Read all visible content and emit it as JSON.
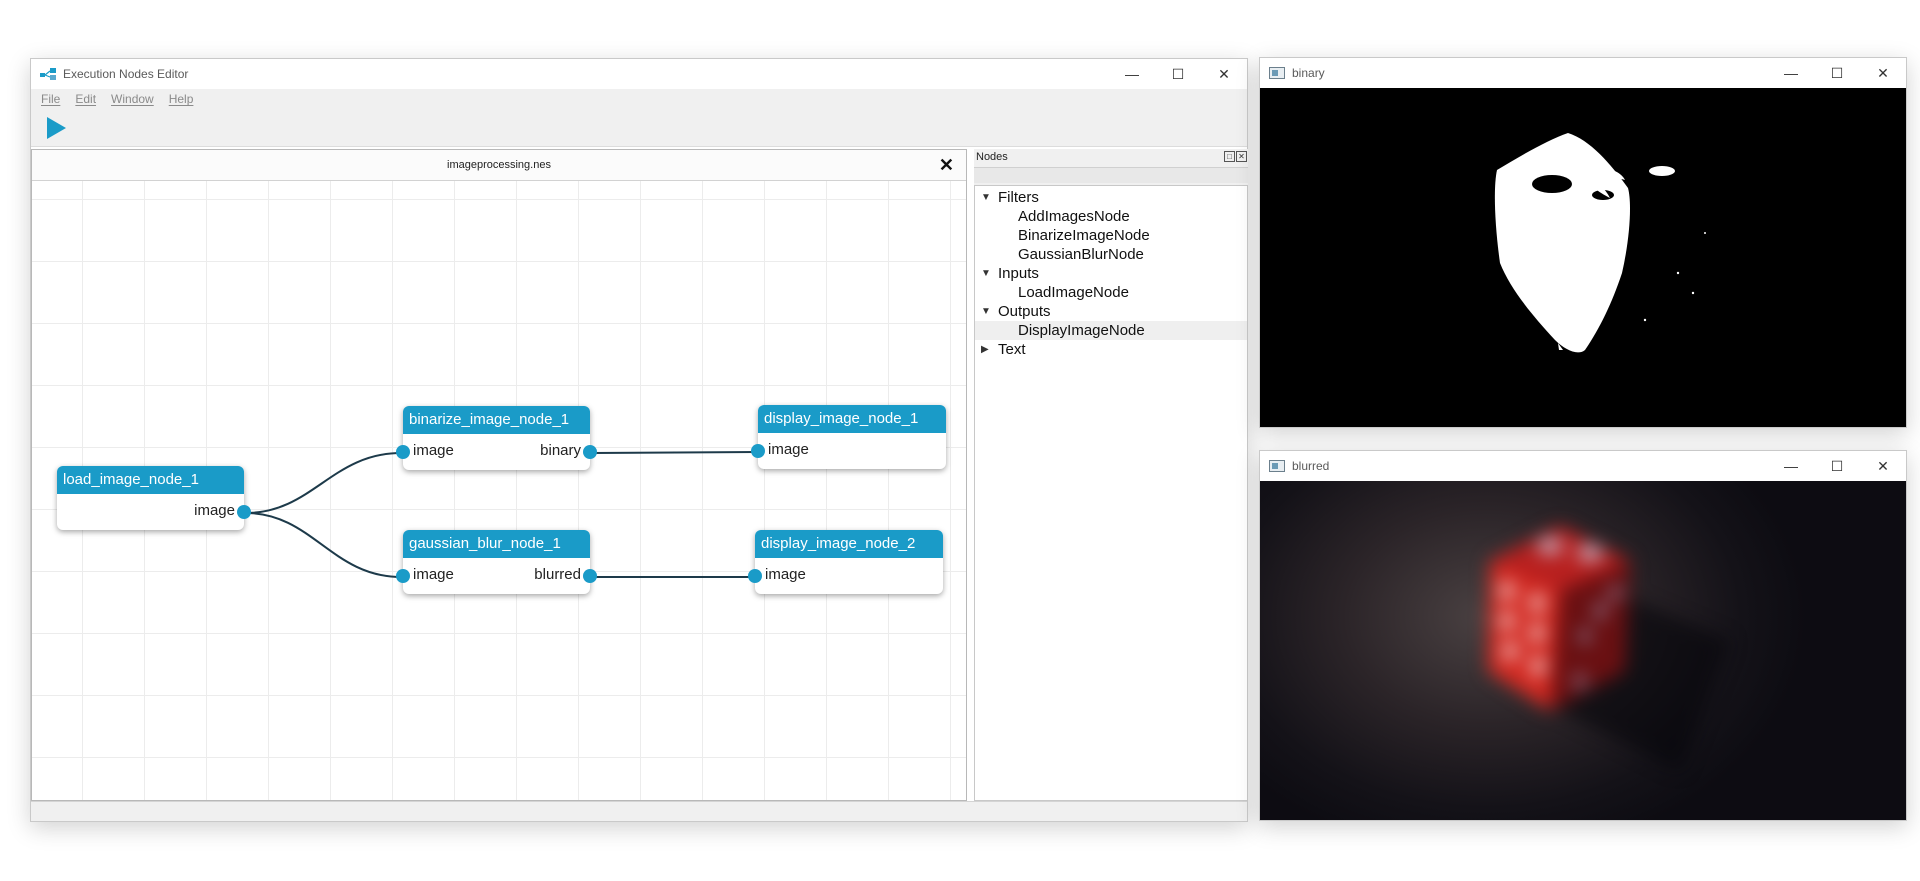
{
  "main_window": {
    "title": "Execution Nodes Editor",
    "menu": [
      "File",
      "Edit",
      "Window",
      "Help"
    ],
    "document_tab": "imageprocessing.nes"
  },
  "graph": {
    "nodes": [
      {
        "id": "load",
        "title": "load_image_node_1",
        "inputs": [],
        "outputs": [
          "image"
        ]
      },
      {
        "id": "binarize",
        "title": "binarize_image_node_1",
        "inputs": [
          "image"
        ],
        "outputs": [
          "binary"
        ]
      },
      {
        "id": "gaussian",
        "title": "gaussian_blur_node_1",
        "inputs": [
          "image"
        ],
        "outputs": [
          "blurred"
        ]
      },
      {
        "id": "display1",
        "title": "display_image_node_1",
        "inputs": [
          "image"
        ],
        "outputs": []
      },
      {
        "id": "display2",
        "title": "display_image_node_2",
        "inputs": [
          "image"
        ],
        "outputs": []
      }
    ],
    "links": [
      {
        "from": "load.image",
        "to": "binarize.image"
      },
      {
        "from": "load.image",
        "to": "gaussian.image"
      },
      {
        "from": "binarize.binary",
        "to": "display1.image"
      },
      {
        "from": "gaussian.blurred",
        "to": "display2.image"
      }
    ]
  },
  "nodes_panel": {
    "title": "Nodes",
    "categories": [
      {
        "label": "Filters",
        "expanded": true,
        "items": [
          "AddImagesNode",
          "BinarizeImageNode",
          "GaussianBlurNode"
        ]
      },
      {
        "label": "Inputs",
        "expanded": true,
        "items": [
          "LoadImageNode"
        ]
      },
      {
        "label": "Outputs",
        "expanded": true,
        "items": [
          "DisplayImageNode"
        ]
      },
      {
        "label": "Text",
        "expanded": false,
        "items": []
      }
    ],
    "selected_item": "DisplayImageNode"
  },
  "image_windows": {
    "binary_title": "binary",
    "blurred_title": "blurred"
  },
  "colors": {
    "node_header": "#1a9bc8",
    "port": "#1a9bc8",
    "link": "#1d3a4a"
  }
}
